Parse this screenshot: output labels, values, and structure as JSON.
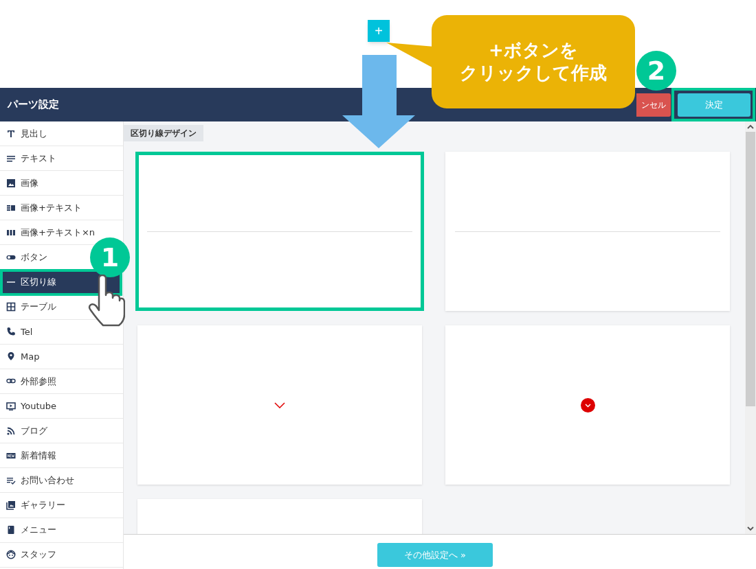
{
  "header": {
    "title": "パーツ設定",
    "cancel_button": "ンセル",
    "confirm_button": "決定"
  },
  "sidebar": {
    "items": [
      {
        "label": "見出し",
        "selected": false
      },
      {
        "label": "テキスト",
        "selected": false
      },
      {
        "label": "画像",
        "selected": false
      },
      {
        "label": "画像+テキスト",
        "selected": false
      },
      {
        "label": "画像+テキスト×n",
        "selected": false
      },
      {
        "label": "ボタン",
        "selected": false
      },
      {
        "label": "区切り線",
        "selected": true
      },
      {
        "label": "テーブル",
        "selected": false
      },
      {
        "label": "Tel",
        "selected": false
      },
      {
        "label": "Map",
        "selected": false
      },
      {
        "label": "外部参照",
        "selected": false
      },
      {
        "label": "Youtube",
        "selected": false
      },
      {
        "label": "ブログ",
        "selected": false
      },
      {
        "label": "新着情報",
        "selected": false
      },
      {
        "label": "お問い合わせ",
        "selected": false
      },
      {
        "label": "ギャラリー",
        "selected": false
      },
      {
        "label": "メニュー",
        "selected": false
      },
      {
        "label": "スタッフ",
        "selected": false
      }
    ]
  },
  "section_tab": "区切り線デザイン",
  "designs": [
    {
      "kind": "line",
      "selected": true
    },
    {
      "kind": "line",
      "selected": false
    },
    {
      "kind": "chevron",
      "selected": false
    },
    {
      "kind": "circle-chevron",
      "selected": false
    },
    {
      "kind": "blank",
      "selected": false
    }
  ],
  "footer_button": "その他設定へ »",
  "annotations": {
    "plus_button": "+",
    "callout": [
      "+ボタンを",
      "クリックして作成"
    ],
    "steps": [
      "1",
      "2"
    ]
  }
}
